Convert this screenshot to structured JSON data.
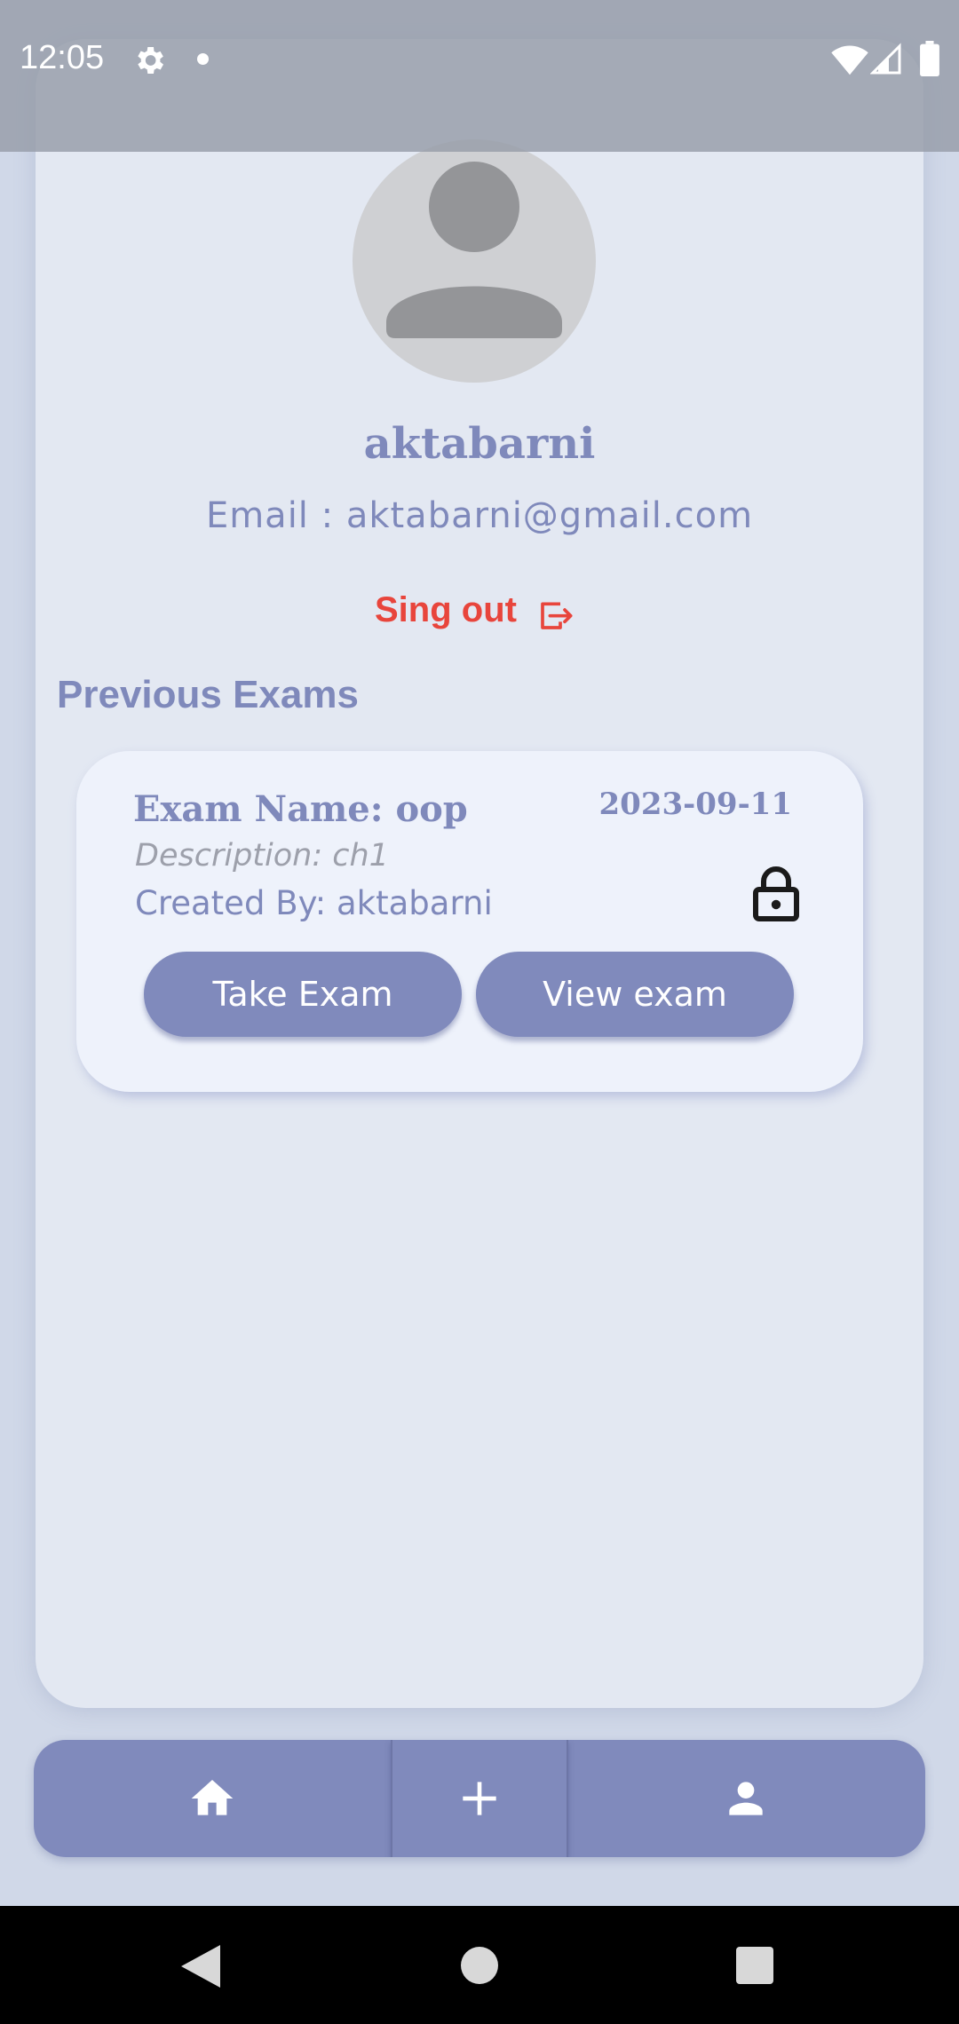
{
  "status_bar": {
    "time": "12:05",
    "icons": [
      "gear-icon",
      "notification-dot-icon",
      "wifi-icon",
      "signal-icon",
      "battery-icon"
    ]
  },
  "profile": {
    "avatar_icon": "person-avatar-icon",
    "username": "aktabarni",
    "email_text": "Email : aktabarni@gmail.com",
    "signout_label": "Sing out",
    "signout_icon": "logout-icon"
  },
  "previous_exams": {
    "title": "Previous Exams",
    "items": [
      {
        "name": "Exam Name: oop",
        "date": "2023-09-11",
        "description": "Description: ch1",
        "created_by": "Created By: aktabarni",
        "status_icon": "lock-icon",
        "take_label": "Take Exam",
        "view_label": "View exam"
      }
    ]
  },
  "bottom_nav": {
    "items": [
      {
        "icon": "home-icon"
      },
      {
        "icon": "plus-icon"
      },
      {
        "icon": "profile-icon"
      }
    ]
  },
  "system_nav": {
    "icons": [
      "back-icon",
      "home-circle-icon",
      "recents-icon"
    ]
  },
  "colors": {
    "accent": "#808abc",
    "text_accent": "#7f89bb",
    "signout": "#e8453c",
    "panel_background": "#e3e8f2",
    "card_background": "#eef2fb"
  }
}
